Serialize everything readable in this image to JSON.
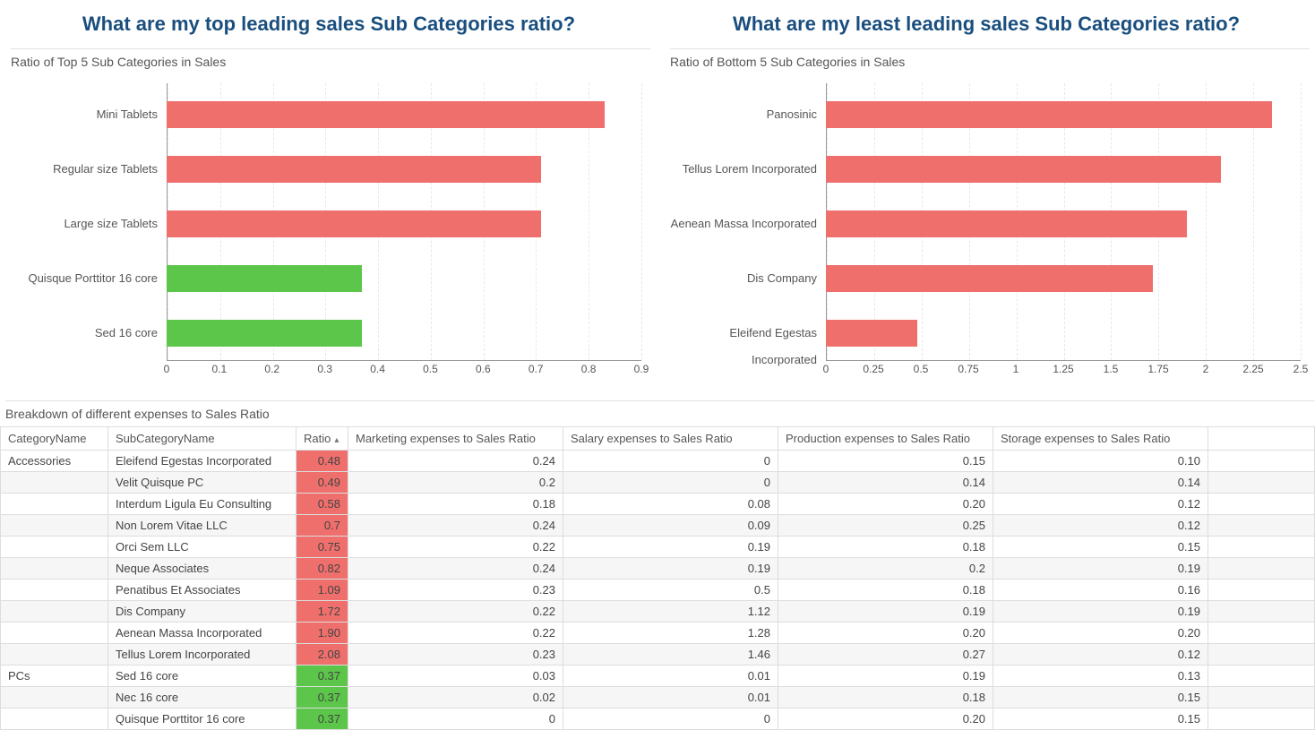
{
  "titles": {
    "left": "What are my top leading sales Sub Categories ratio?",
    "right": "What are my least leading sales Sub Categories ratio?"
  },
  "chart_data": [
    {
      "type": "bar",
      "orientation": "horizontal",
      "title": "Ratio of Top 5 Sub Categories in Sales",
      "categories": [
        "Mini Tablets",
        "Regular size Tablets",
        "Large size Tablets",
        "Quisque Porttitor 16 core",
        "Sed 16 core"
      ],
      "values": [
        0.83,
        0.71,
        0.71,
        0.37,
        0.37
      ],
      "colors": [
        "red",
        "red",
        "red",
        "green",
        "green"
      ],
      "xlim": [
        0,
        0.9
      ],
      "xticks": [
        0,
        0.1,
        0.2,
        0.3,
        0.4,
        0.5,
        0.6,
        0.7,
        0.8,
        0.9
      ]
    },
    {
      "type": "bar",
      "orientation": "horizontal",
      "title": "Ratio of Bottom 5 Sub Categories in Sales",
      "categories": [
        "Panosinic",
        "Tellus Lorem Incorporated",
        "Aenean Massa Incorporated",
        "Dis Company",
        "Eleifend Egestas Incorporated"
      ],
      "values": [
        2.35,
        2.08,
        1.9,
        1.72,
        0.48
      ],
      "colors": [
        "red",
        "red",
        "red",
        "red",
        "red"
      ],
      "xlim": [
        0,
        2.5
      ],
      "xticks": [
        0,
        0.25,
        0.5,
        0.75,
        1,
        1.25,
        1.5,
        1.75,
        2,
        2.25,
        2.5
      ]
    }
  ],
  "table": {
    "title": "Breakdown of different expenses to Sales Ratio",
    "sort_column": "Ratio",
    "sort_dir": "asc",
    "columns": [
      "CategoryName",
      "SubCategoryName",
      "Ratio",
      "Marketing expenses to Sales Ratio",
      "Salary expenses to Sales Ratio",
      "Production expenses to Sales Ratio",
      "Storage expenses to Sales Ratio"
    ],
    "rows": [
      {
        "cat": "Accessories",
        "sub": "Eleifend Egestas Incorporated",
        "ratio": "0.48",
        "ratioColor": "red",
        "m": "0.24",
        "s": "0",
        "p": "0.15",
        "st": "0.10"
      },
      {
        "cat": "",
        "sub": "Velit Quisque PC",
        "ratio": "0.49",
        "ratioColor": "red",
        "m": "0.2",
        "s": "0",
        "p": "0.14",
        "st": "0.14"
      },
      {
        "cat": "",
        "sub": "Interdum Ligula Eu Consulting",
        "ratio": "0.58",
        "ratioColor": "red",
        "m": "0.18",
        "s": "0.08",
        "p": "0.20",
        "st": "0.12"
      },
      {
        "cat": "",
        "sub": "Non Lorem Vitae LLC",
        "ratio": "0.7",
        "ratioColor": "red",
        "m": "0.24",
        "s": "0.09",
        "p": "0.25",
        "st": "0.12"
      },
      {
        "cat": "",
        "sub": "Orci Sem LLC",
        "ratio": "0.75",
        "ratioColor": "red",
        "m": "0.22",
        "s": "0.19",
        "p": "0.18",
        "st": "0.15"
      },
      {
        "cat": "",
        "sub": "Neque Associates",
        "ratio": "0.82",
        "ratioColor": "red",
        "m": "0.24",
        "s": "0.19",
        "p": "0.2",
        "st": "0.19"
      },
      {
        "cat": "",
        "sub": "Penatibus Et Associates",
        "ratio": "1.09",
        "ratioColor": "red",
        "m": "0.23",
        "s": "0.5",
        "p": "0.18",
        "st": "0.16"
      },
      {
        "cat": "",
        "sub": "Dis Company",
        "ratio": "1.72",
        "ratioColor": "red",
        "m": "0.22",
        "s": "1.12",
        "p": "0.19",
        "st": "0.19"
      },
      {
        "cat": "",
        "sub": "Aenean Massa Incorporated",
        "ratio": "1.90",
        "ratioColor": "red",
        "m": "0.22",
        "s": "1.28",
        "p": "0.20",
        "st": "0.20"
      },
      {
        "cat": "",
        "sub": "Tellus Lorem Incorporated",
        "ratio": "2.08",
        "ratioColor": "red",
        "m": "0.23",
        "s": "1.46",
        "p": "0.27",
        "st": "0.12"
      },
      {
        "cat": "PCs",
        "sub": "Sed 16 core",
        "ratio": "0.37",
        "ratioColor": "green",
        "m": "0.03",
        "s": "0.01",
        "p": "0.19",
        "st": "0.13"
      },
      {
        "cat": "",
        "sub": "Nec 16 core",
        "ratio": "0.37",
        "ratioColor": "green",
        "m": "0.02",
        "s": "0.01",
        "p": "0.18",
        "st": "0.15"
      },
      {
        "cat": "",
        "sub": "Quisque Porttitor 16 core",
        "ratio": "0.37",
        "ratioColor": "green",
        "m": "0",
        "s": "0",
        "p": "0.20",
        "st": "0.15"
      }
    ]
  },
  "colors": {
    "red": "#ef6f6c",
    "green": "#5cc64a"
  }
}
